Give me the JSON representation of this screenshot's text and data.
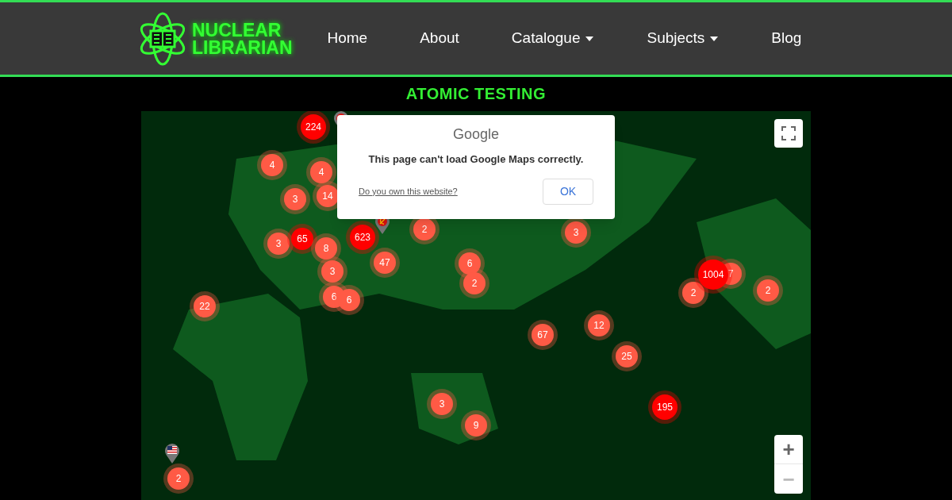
{
  "logo": {
    "line1": "NUCLEAR",
    "line2": "LIBRARIAN"
  },
  "nav": [
    {
      "label": "Home",
      "has_dropdown": false
    },
    {
      "label": "About",
      "has_dropdown": false
    },
    {
      "label": "Catalogue",
      "has_dropdown": true
    },
    {
      "label": "Subjects",
      "has_dropdown": true
    },
    {
      "label": "Blog",
      "has_dropdown": false
    }
  ],
  "page_title": "ATOMIC TESTING",
  "map": {
    "clusters": [
      {
        "count": "224",
        "color": "#ff0000"
      },
      {
        "count": "4",
        "color": "#ff5a45"
      },
      {
        "count": "4",
        "color": "#ff5a45"
      },
      {
        "count": "3",
        "color": "#ff5a45"
      },
      {
        "count": "14",
        "color": "#ff5a45"
      },
      {
        "count": "2",
        "color": "#ff5a45"
      },
      {
        "count": "3",
        "color": "#ff5a45"
      },
      {
        "count": "3",
        "color": "#ff5a45"
      },
      {
        "count": "65",
        "color": "#ff0000"
      },
      {
        "count": "8",
        "color": "#ff5a45"
      },
      {
        "count": "623",
        "color": "#ff0000"
      },
      {
        "count": "3",
        "color": "#ff5a45"
      },
      {
        "count": "47",
        "color": "#ff5a45"
      },
      {
        "count": "6",
        "color": "#ff5a45"
      },
      {
        "count": "1004",
        "color": "#ff0000"
      },
      {
        "count": "7",
        "color": "#ff5a45"
      },
      {
        "count": "6",
        "color": "#ff5a45"
      },
      {
        "count": "6",
        "color": "#ff5a45"
      },
      {
        "count": "2",
        "color": "#ff5a45"
      },
      {
        "count": "2",
        "color": "#ff5a45"
      },
      {
        "count": "2",
        "color": "#ff5a45"
      },
      {
        "count": "22",
        "color": "#ff5a45"
      },
      {
        "count": "67",
        "color": "#ff5a45"
      },
      {
        "count": "12",
        "color": "#ff5a45"
      },
      {
        "count": "25",
        "color": "#ff5a45"
      },
      {
        "count": "3",
        "color": "#ff5a45"
      },
      {
        "count": "195",
        "color": "#ff0000"
      },
      {
        "count": "9",
        "color": "#ff5a45"
      },
      {
        "count": "2",
        "color": "#ff5a45"
      }
    ],
    "pins": [
      {
        "kind": "soviet"
      },
      {
        "kind": "soviet"
      },
      {
        "kind": "usa"
      }
    ],
    "dialog": {
      "brand": "Google",
      "message": "This page can't load Google Maps correctly.",
      "link": "Do you own this website?",
      "button": "OK"
    },
    "zoom_in": "+",
    "zoom_out": "−"
  }
}
